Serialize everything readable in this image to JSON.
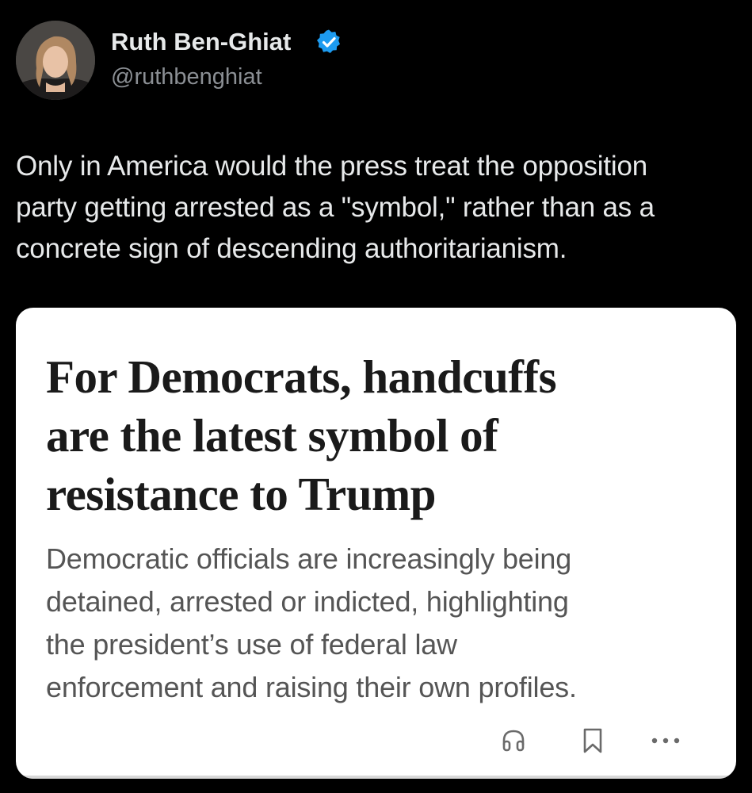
{
  "author": {
    "name": "Ruth Ben-Ghiat",
    "handle": "@ruthbenghiat",
    "verified_icon": "verified-badge-icon",
    "verified_color": "#1d9bf0"
  },
  "tweet": {
    "lines": [
      "Only in America would the press treat the opposition",
      "party getting arrested as a \"symbol,\" rather than as a",
      "concrete sign of descending authoritarianism."
    ]
  },
  "article": {
    "headline_lines": [
      "For Democrats, handcuffs",
      "are the latest symbol of",
      "resistance to Trump"
    ],
    "deck_lines": [
      "Democratic officials are increasingly being",
      "detained, arrested or indicted, highlighting",
      "the president’s use of federal law",
      "enforcement and raising their own profiles."
    ],
    "actions": [
      {
        "name": "listen",
        "icon": "headphones-icon"
      },
      {
        "name": "save",
        "icon": "bookmark-icon"
      },
      {
        "name": "more",
        "icon": "more-options-icon"
      }
    ]
  },
  "colors": {
    "background": "#000000",
    "primary_text": "#e7e9ea",
    "secondary_text": "#8b8f94",
    "card_background": "#ffffff",
    "headline": "#1a1a1a",
    "deck": "#555555"
  }
}
